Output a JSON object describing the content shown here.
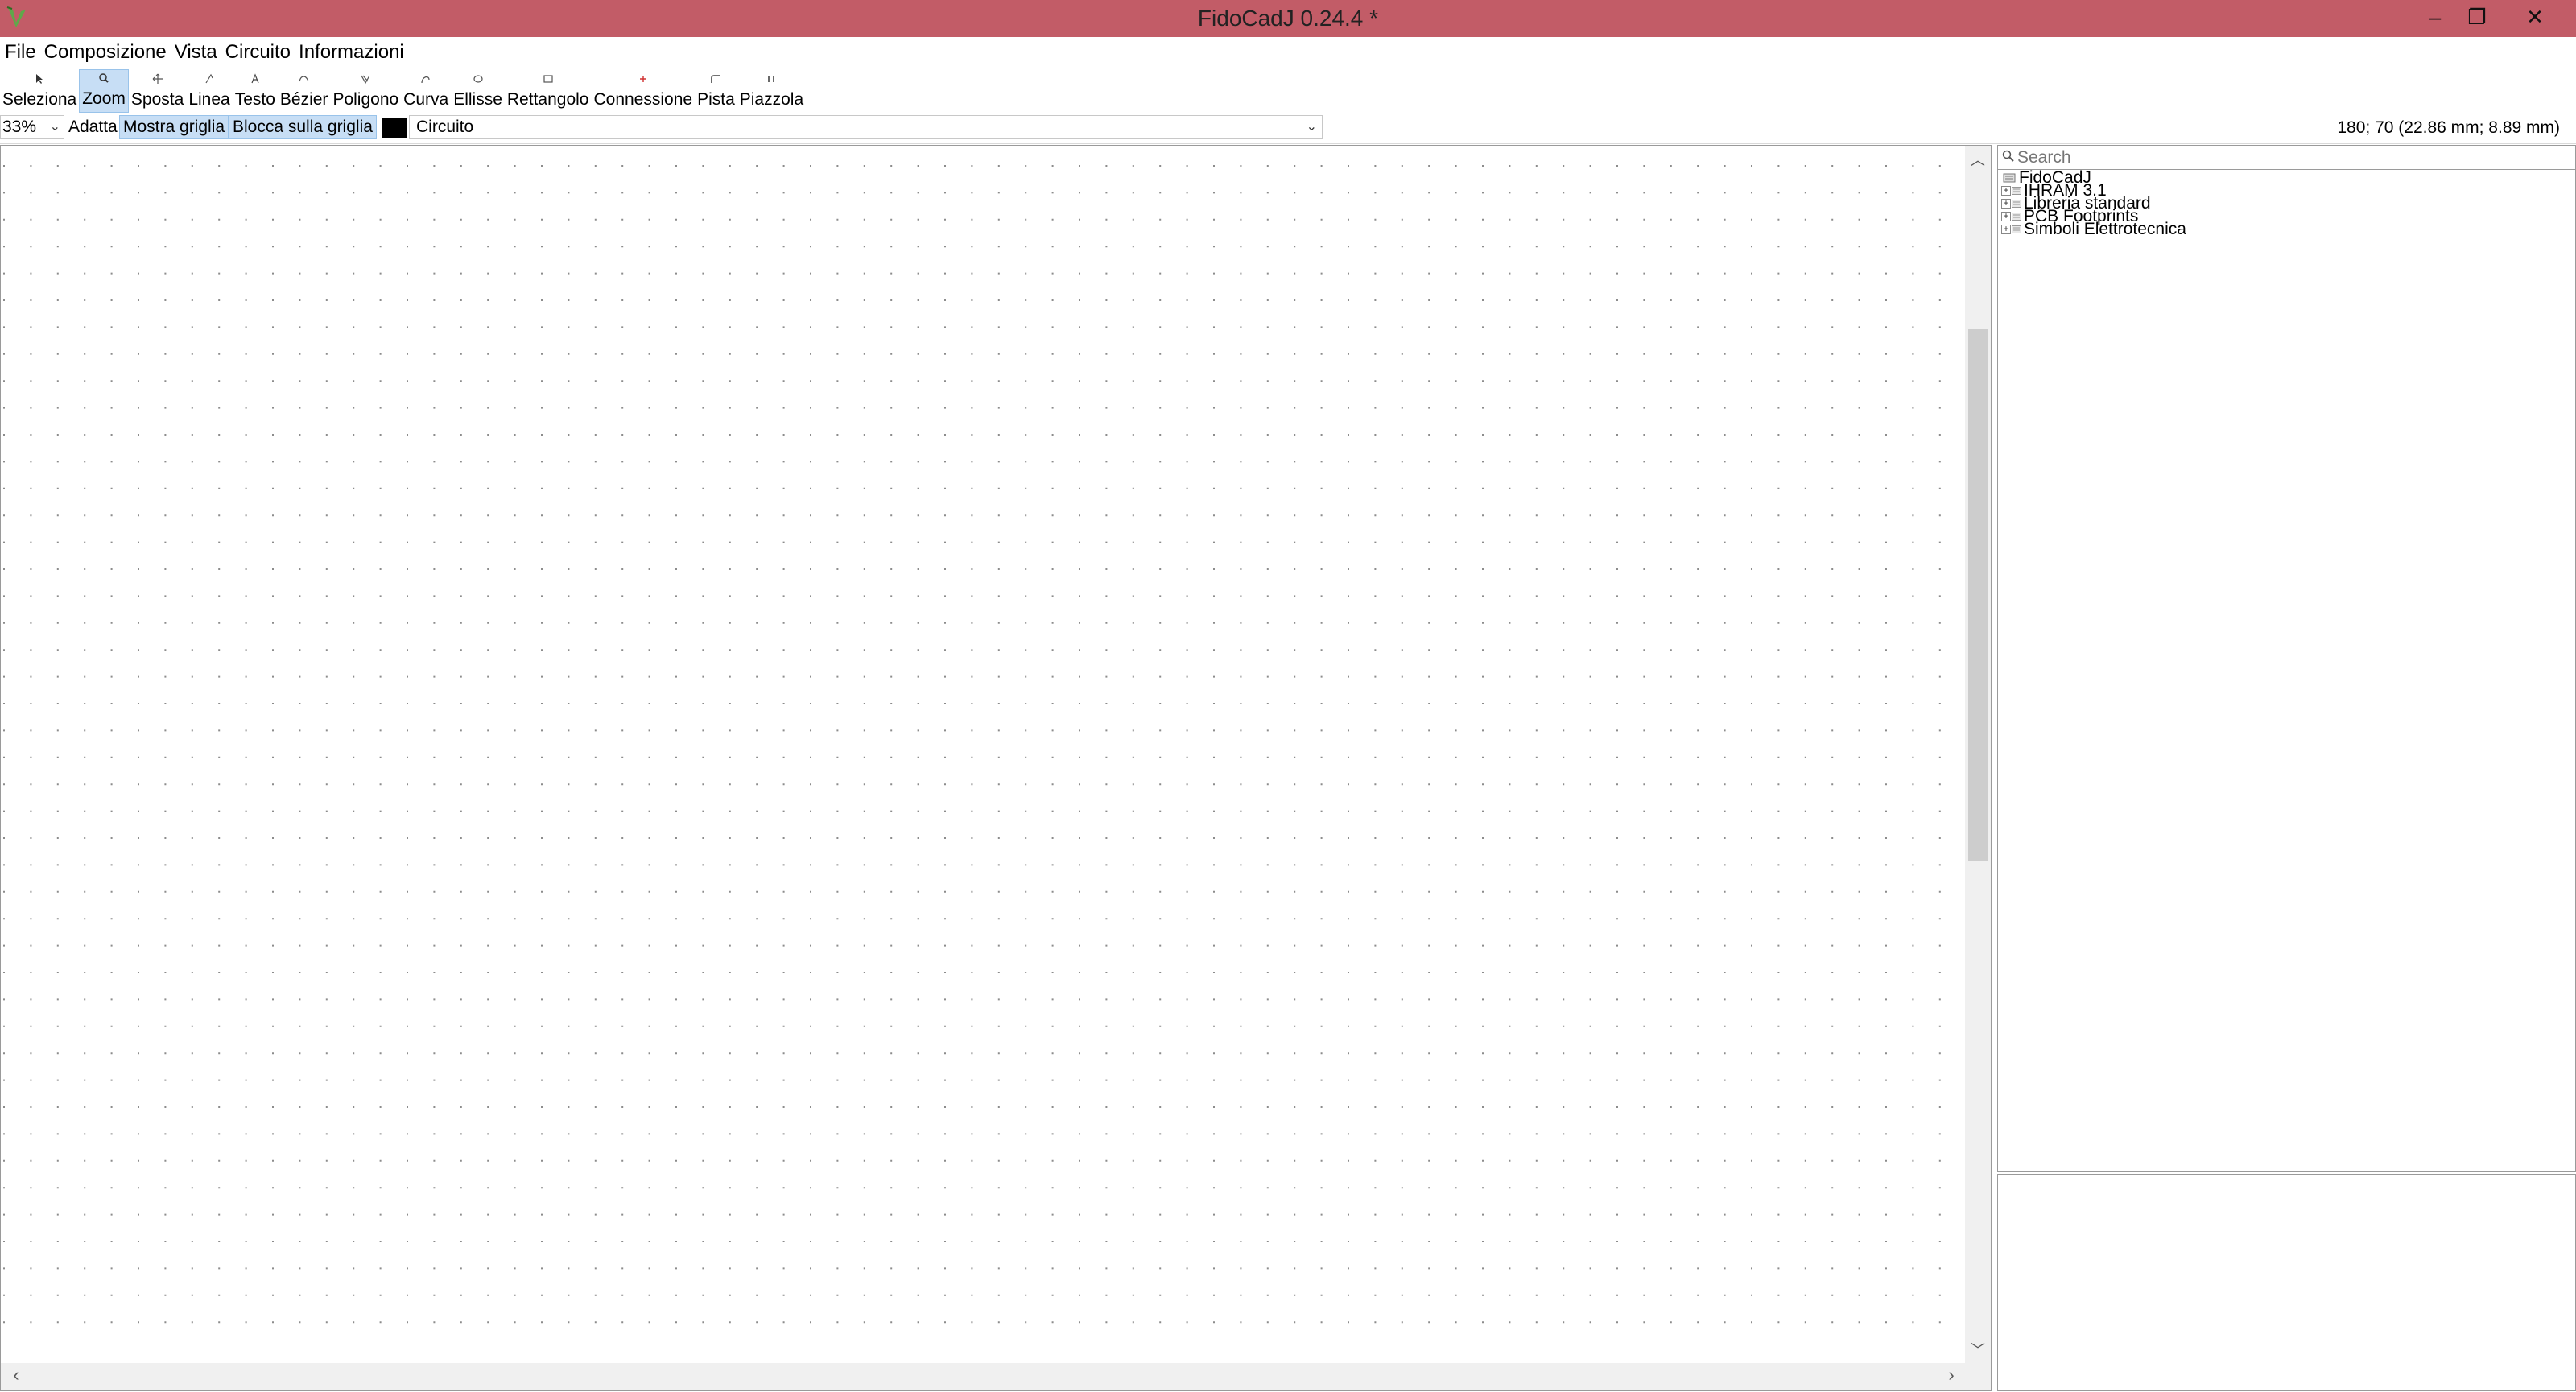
{
  "window": {
    "title": "FidoCadJ 0.24.4  *",
    "minimize_glyph": "–",
    "maximize_glyph": "❐",
    "close_glyph": "✕"
  },
  "menu": [
    "File",
    "Composizione",
    "Vista",
    "Circuito",
    "Informazioni"
  ],
  "toolbar": {
    "tools": [
      {
        "label": "Seleziona",
        "icon": "select-arrow-icon",
        "active": false
      },
      {
        "label": "Zoom",
        "icon": "zoom-icon",
        "active": true
      },
      {
        "label": "Sposta",
        "icon": "move-icon",
        "active": false
      },
      {
        "label": "Linea",
        "icon": "line-icon",
        "active": false
      },
      {
        "label": "Testo",
        "icon": "text-icon",
        "active": false
      },
      {
        "label": "Bézier",
        "icon": "bezier-icon",
        "active": false
      },
      {
        "label": "Poligono",
        "icon": "polygon-icon",
        "active": false
      },
      {
        "label": "Curva",
        "icon": "curve-icon",
        "active": false
      },
      {
        "label": "Ellisse",
        "icon": "ellipse-icon",
        "active": false
      },
      {
        "label": "Rettangolo",
        "icon": "rectangle-icon",
        "active": false
      },
      {
        "label": "Connessione",
        "icon": "connection-icon",
        "active": false
      },
      {
        "label": "Pista",
        "icon": "track-icon",
        "active": false
      },
      {
        "label": "Piazzola",
        "icon": "pad-icon",
        "active": false
      }
    ]
  },
  "options": {
    "zoom_value": "33%",
    "fit_label": "Adatta",
    "show_grid_label": "Mostra griglia",
    "snap_grid_label": "Blocca sulla griglia",
    "layer_color": "#000000",
    "layer_name": "Circuito",
    "coordinates": "180; 70 (22.86 mm; 8.89 mm)"
  },
  "library": {
    "search_placeholder": "Search",
    "root": "FidoCadJ",
    "items": [
      "IHRAM 3.1",
      "Libreria standard",
      "PCB Footprints",
      "Simboli Elettrotecnica"
    ]
  },
  "colors": {
    "titlebar": "#c25c67",
    "active_tool": "#c7def5",
    "grid_dot": "#8c8c8c"
  }
}
